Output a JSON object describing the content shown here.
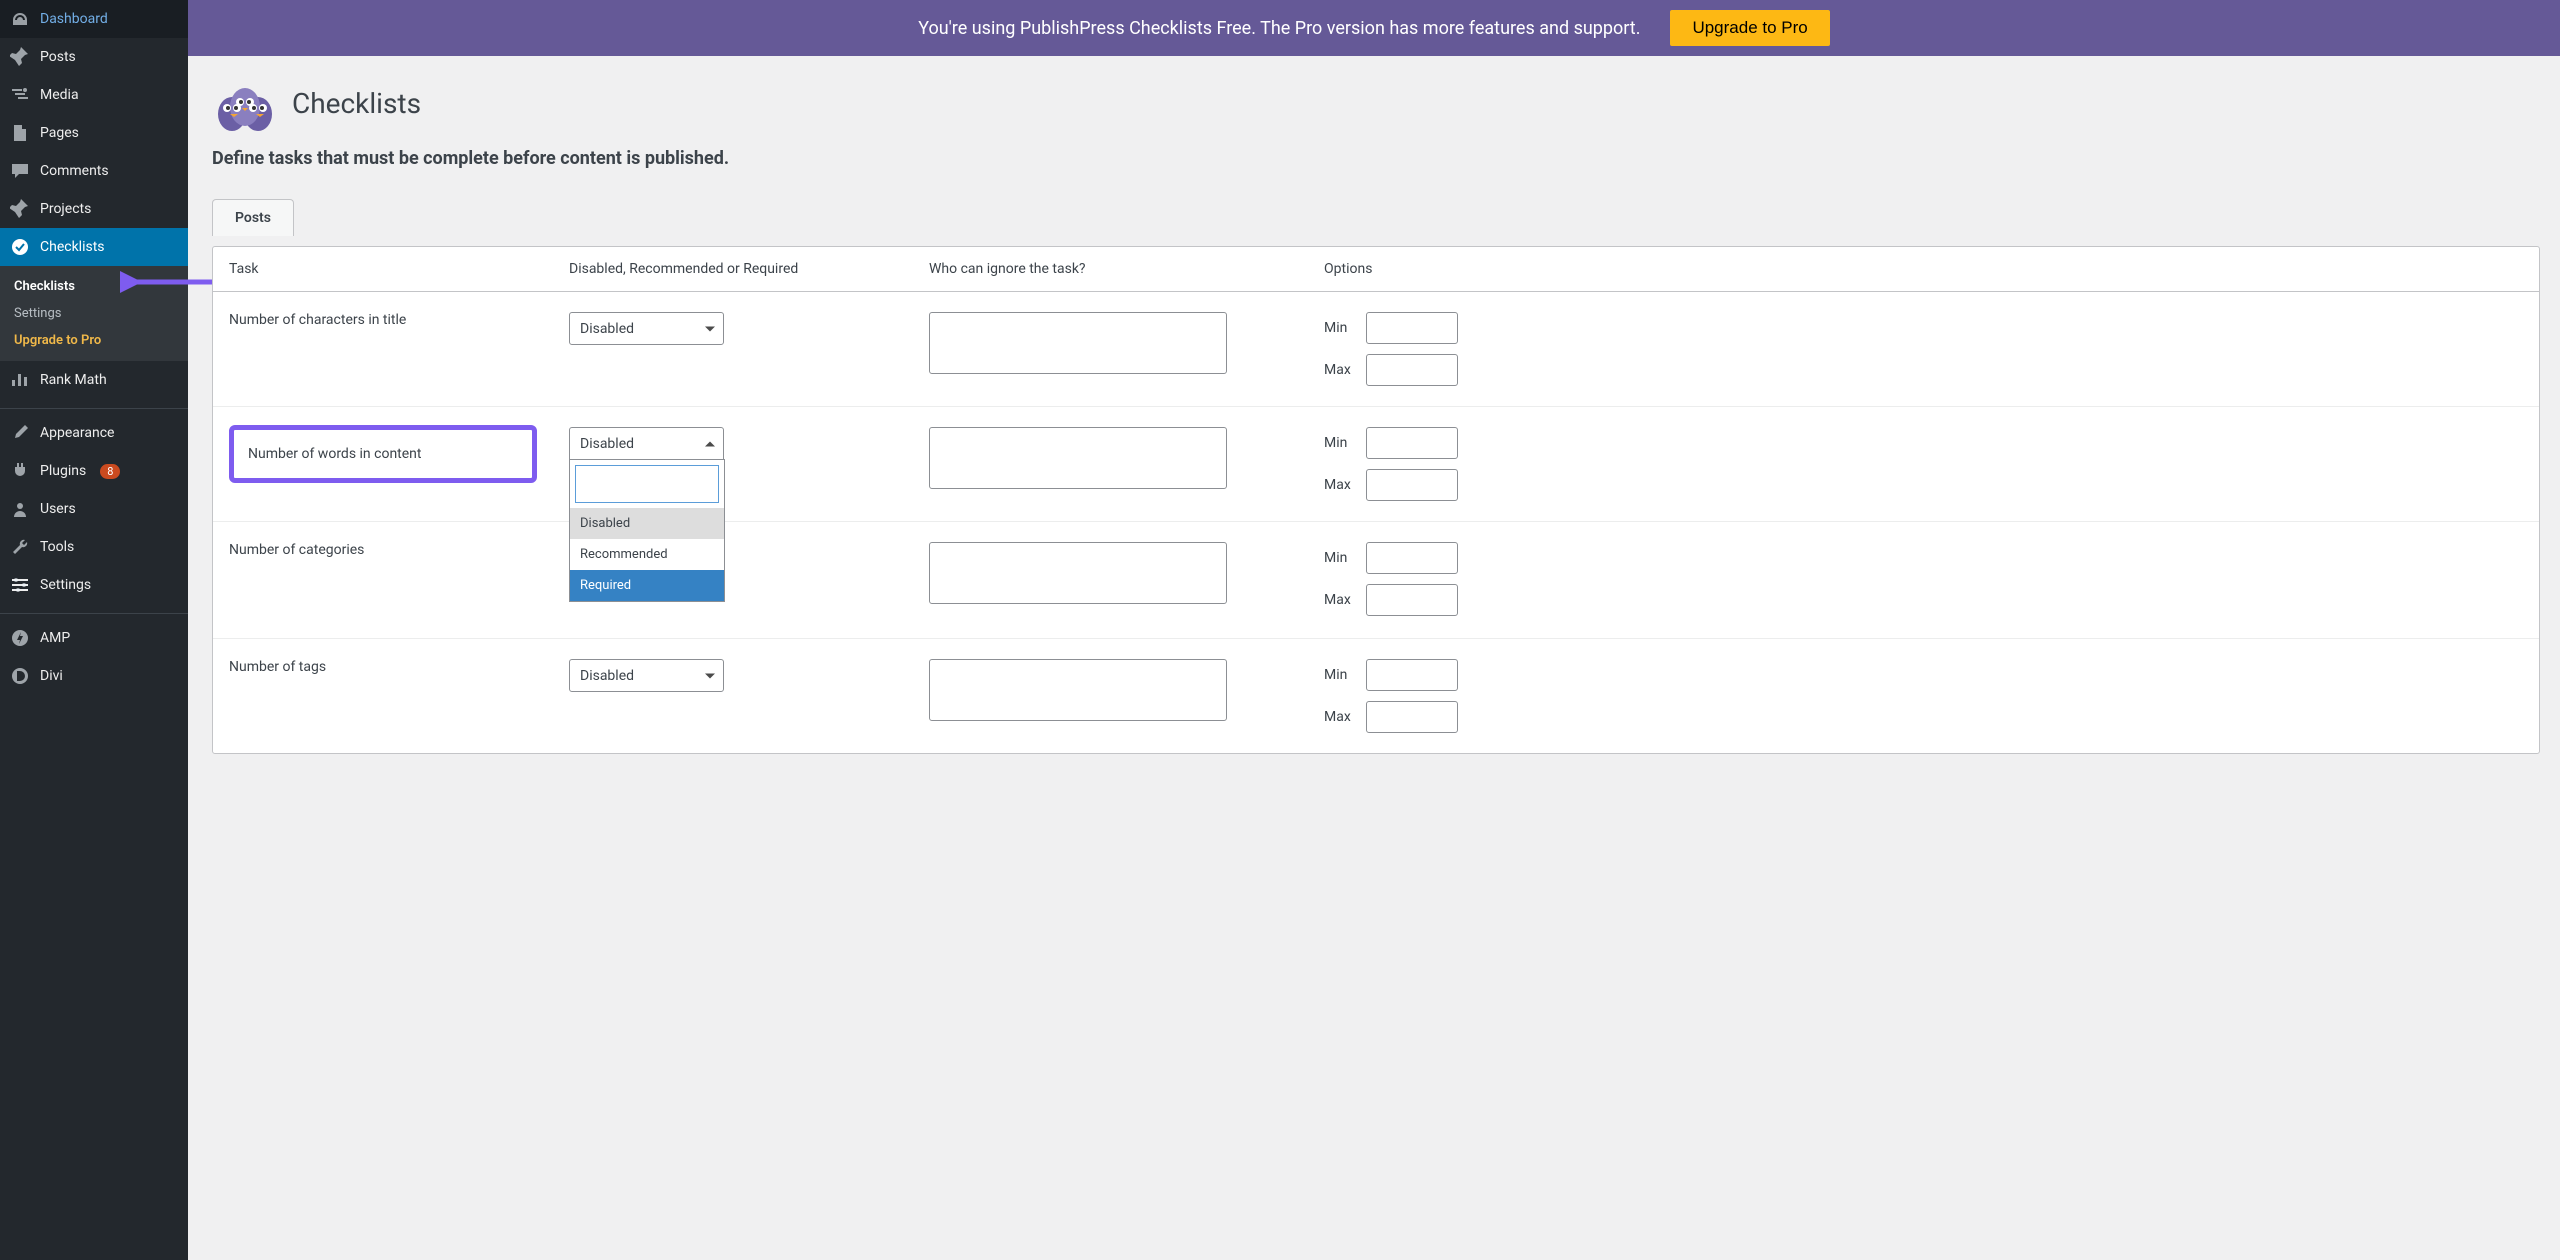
{
  "sidebar": {
    "items": [
      {
        "label": "Dashboard",
        "icon": "dashboard"
      },
      {
        "label": "Posts",
        "icon": "pin"
      },
      {
        "label": "Media",
        "icon": "media"
      },
      {
        "label": "Pages",
        "icon": "page"
      },
      {
        "label": "Comments",
        "icon": "comment"
      },
      {
        "label": "Projects",
        "icon": "pin"
      },
      {
        "label": "Checklists",
        "icon": "check"
      },
      {
        "label": "Rank Math",
        "icon": "chart"
      },
      {
        "label": "Appearance",
        "icon": "brush"
      },
      {
        "label": "Plugins",
        "icon": "plug",
        "badge": "8"
      },
      {
        "label": "Users",
        "icon": "user"
      },
      {
        "label": "Tools",
        "icon": "wrench"
      },
      {
        "label": "Settings",
        "icon": "sliders"
      },
      {
        "label": "AMP",
        "icon": "amp"
      },
      {
        "label": "Divi",
        "icon": "divi"
      }
    ],
    "submenu": [
      {
        "label": "Checklists",
        "active": true
      },
      {
        "label": "Settings"
      },
      {
        "label": "Upgrade to Pro",
        "upgrade": true
      }
    ]
  },
  "banner": {
    "text": "You're using PublishPress Checklists Free. The Pro version has more features and support.",
    "cta": "Upgrade to Pro"
  },
  "page": {
    "title": "Checklists",
    "subtitle": "Define tasks that must be complete before content is published."
  },
  "tabs": [
    {
      "label": "Posts"
    }
  ],
  "headers": {
    "task": "Task",
    "status": "Disabled, Recommended or Required",
    "ignore": "Who can ignore the task?",
    "options": "Options"
  },
  "labels": {
    "min": "Min",
    "max": "Max"
  },
  "status_options": [
    "Disabled",
    "Recommended",
    "Required"
  ],
  "rows": [
    {
      "task": "Number of characters in title",
      "status": "Disabled",
      "min": "",
      "max": ""
    },
    {
      "task": "Number of words in content",
      "status": "Disabled",
      "min": "",
      "max": "",
      "highlight": true,
      "open": true
    },
    {
      "task": "Number of categories",
      "status": "",
      "min": "",
      "max": ""
    },
    {
      "task": "Number of tags",
      "status": "Disabled",
      "min": "",
      "max": ""
    }
  ],
  "colors": {
    "banner": "#655997",
    "cta": "#fdb814",
    "highlight": "#7e5cef",
    "option_hover": "#3582c4"
  }
}
